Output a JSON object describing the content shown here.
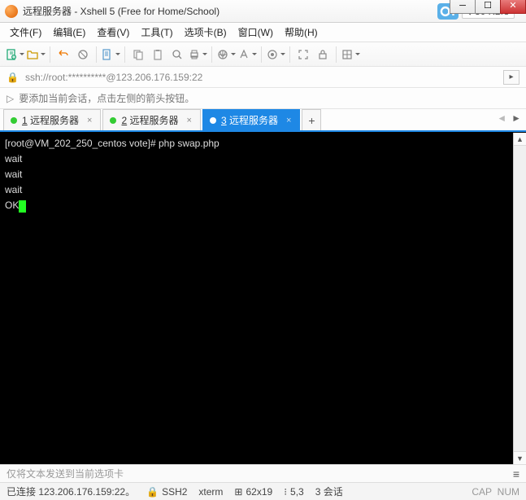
{
  "window": {
    "title": "远程服务器 - Xshell 5 (Free for Home/School)",
    "net_speed": "30 KB/s"
  },
  "menu": {
    "file": "文件(F)",
    "edit": "编辑(E)",
    "view": "查看(V)",
    "tools": "工具(T)",
    "tab": "选项卡(B)",
    "window": "窗口(W)",
    "help": "帮助(H)"
  },
  "address": {
    "scheme": "ssh://",
    "path": "root:**********@123.206.176.159:22"
  },
  "hint": {
    "text": "要添加当前会话，点击左侧的箭头按钮。"
  },
  "tabs": {
    "items": [
      {
        "num": "1",
        "label": "远程服务器"
      },
      {
        "num": "2",
        "label": "远程服务器"
      },
      {
        "num": "3",
        "label": "远程服务器"
      }
    ],
    "add": "+"
  },
  "terminal": {
    "prompt": "[root@VM_202_250_centos vote]# ",
    "command": "php swap.php",
    "lines": [
      "wait",
      "wait",
      "wait"
    ],
    "last": "OK"
  },
  "sendbar": {
    "placeholder": "仅将文本发送到当前选项卡"
  },
  "status": {
    "conn": "已连接 123.206.176.159:22。",
    "proto": "SSH2",
    "term_type": "xterm",
    "size": "62x19",
    "coord": "5,3",
    "sessions": "3 会话",
    "caps": "CAP",
    "num": "NUM"
  },
  "icons": {
    "new": "new-doc-icon",
    "open": "folder-icon",
    "copy": "copy-icon",
    "paste": "paste-icon",
    "search": "search-icon",
    "props": "props-icon"
  }
}
